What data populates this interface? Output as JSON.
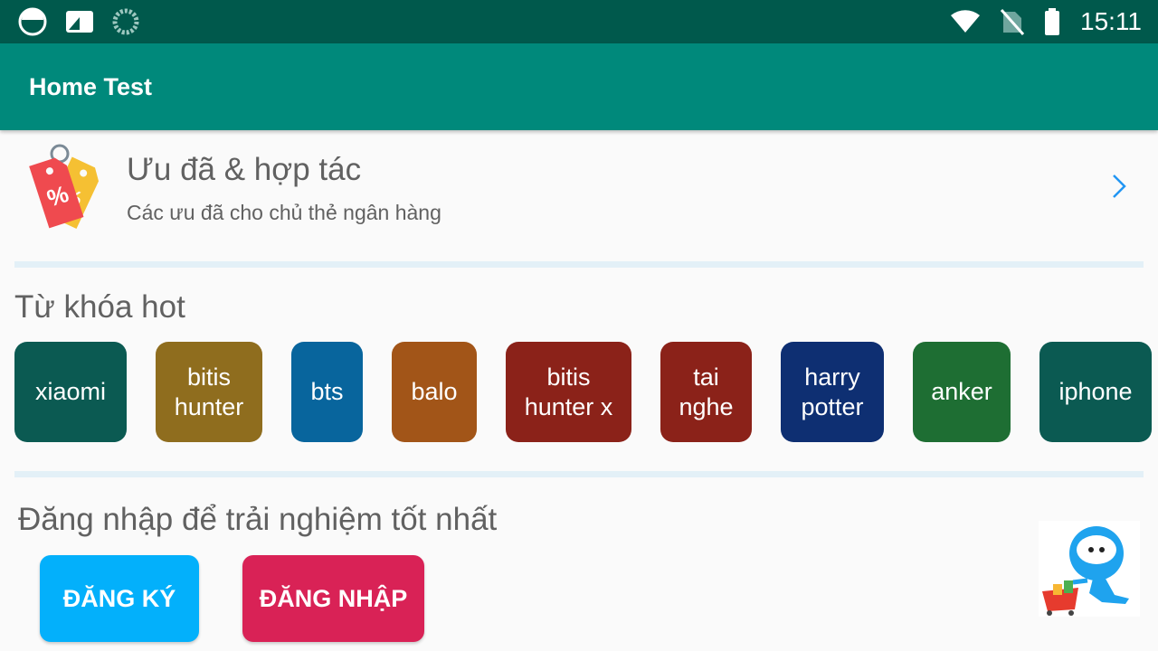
{
  "status_bar": {
    "time": "15:11",
    "icons": [
      "notification-circle-icon",
      "gallery-icon",
      "loading-icon",
      "wifi-icon",
      "no-sim-icon",
      "battery-icon"
    ]
  },
  "app_bar": {
    "title": "Home Test"
  },
  "promo": {
    "icon": "discount-tag-icon",
    "title": "Ưu đã & hợp tác",
    "subtitle": "Các ưu đã cho chủ thẻ ngân hàng"
  },
  "hot_keywords": {
    "title": "Từ khóa hot",
    "items": [
      {
        "label": "xiaomi",
        "color": "#0b5a52"
      },
      {
        "label": "bitis hunter",
        "color": "#8f6d1e"
      },
      {
        "label": "bts",
        "color": "#08659d"
      },
      {
        "label": "balo",
        "color": "#a25518"
      },
      {
        "label": "bitis hunter x",
        "color": "#8b2219"
      },
      {
        "label": "tai nghe",
        "color": "#8b2219"
      },
      {
        "label": "harry potter",
        "color": "#0e2f72"
      },
      {
        "label": "anker",
        "color": "#1e6e33"
      },
      {
        "label": "iphone",
        "color": "#0b5a52"
      }
    ]
  },
  "login": {
    "title": "Đăng nhập để trải nghiệm tốt nhất",
    "register_label": "ĐĂNG KÝ",
    "login_label": "ĐĂNG NHẬP",
    "register_color": "#03b0fb",
    "login_color": "#d92256"
  },
  "mascot": {
    "icon": "shopping-mascot-icon"
  }
}
